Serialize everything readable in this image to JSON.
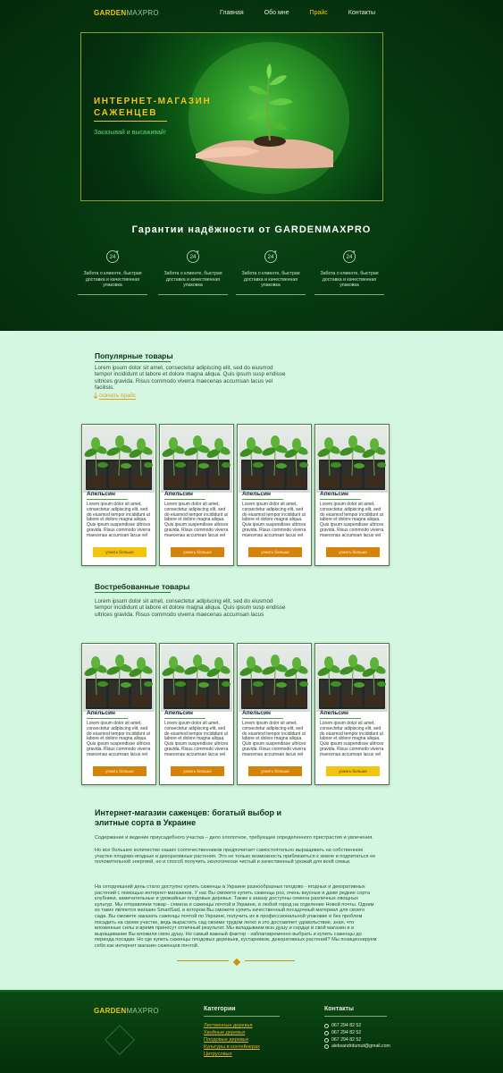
{
  "brand": {
    "part1": "GARDEN",
    "part2": "MAXPRO"
  },
  "nav": [
    {
      "label": "Главная",
      "active": false
    },
    {
      "label": "Обо мне",
      "active": false
    },
    {
      "label": "Прайс",
      "active": true
    },
    {
      "label": "Контакты",
      "active": false
    }
  ],
  "hero": {
    "title": "ИНТЕРНЕТ-МАГАЗИН САЖЕНЦЕВ",
    "subtitle": "Заказывай и высаживай!"
  },
  "guarantee": {
    "title": "Гарантии надёжности от GARDENMAXPRO",
    "features": [
      {
        "icon": "24",
        "text": "Забота о клиенте, быстрая доставка и качественная упаковка"
      },
      {
        "icon": "24",
        "text": "Забота о клиенте, быстрая доставка и качественная упаковка"
      },
      {
        "icon": "24",
        "text": "Забота о клиенте, быстрая доставка и качественная упаковка"
      },
      {
        "icon": "24",
        "text": "Забота о клиенте, быстрая доставка и качественная упаковка"
      }
    ]
  },
  "popular": {
    "title": "Популярные товары",
    "text": "Lorem ipsum dolor sit amet, consectetur adipiscing elit, sed do eiusmod tempor incididunt ut labore et dolore magna aliqua. Quis ipsum susp endisse ultrices gravida. Risus commodo viverra maecenas accumsan lacus vel facilisis.",
    "link": "скачать прайс"
  },
  "demanded": {
    "title": "Востребованные товары",
    "text": "Lorem ipsum dolor sit amet, consectetur adipiscing elit, sed do eiusmod tempor incididunt ut labore et dolore magna aliqua. Quis ipsum susp endisse ultrices gravida. Risus commodo viverra maecenas accumsan lacus"
  },
  "product": {
    "name": "Апельсин",
    "text": "Lorem ipsum dolor sit amet, consectetur adipiscing elit, sed do eiusmod tempor incididunt ut labore et dolore magna aliqua. Quis ipsum suspendisse ultrices gravida. Risus commodo viverra maecenas accumsan lacus vel",
    "button": "узнать больше"
  },
  "shop": {
    "title": "Интернет-магазин саженцев: богатый выбор и элитные сорта в Украине",
    "p1": "Содержание и ведение приусадебного участка – дело хлопотное, требующее определенного пристрастия и увлечения.",
    "p2": "Но все большее количество наших соотечественников предпочитает самостоятельно выращивать на собственном участке плодово-ягодные и декоративные растения. Это не только возможность приблизиться к земле и подпитаться ее положительной энергией, но и способ получить экологически чистый и качественный урожай для всей семьи.",
    "p3": "На сегодняшний день стало доступно купить саженцы в Украине разнообразных плодово - ягодных и декоративных растений с помощью интернет-магазинов. У нас Вы сможете купить саженцы роз, очень вкусные и даже редкие сорта клубники, замечательные и урожайные плодовые деревья. Также к заказу доступны семена различных овощных культур. Мы отправляем товар - семена и саженцы почтой в Украине, в любой город на отделение Новой почты. Одним из таких является магазин SmartSad, в котором Вы сможете купить качественный посадочный материал для своего сада. Вы сможете заказать саженцы почтой по Украине, получить их в профессиональной упаковке и без проблем посадить на своем участке, ведь вырастить сад своими трудом легко и это доставляет удовольствие, зная, что вложенные силы и время принесут отличный результат. Мы вкладываем всю душу и сердце в свой магазин и в выращивание Вы вложили свою душу. Но самый важный фактор - заблаговременно выбрать и купить саженцы до периода посадки. Но где купить саженцы плодовых деревьев, кустарников, декоративных растений? Мы позиционируем себя как интернет магазин саженцев почтой."
  },
  "footer": {
    "categories_title": "Категории",
    "categories": [
      "Лиственные деревья",
      "Хвойные деревья",
      "Плодовые деревья",
      "Культуры в контейнерах",
      "Цитрусовые"
    ],
    "contacts_title": "Контакты",
    "phones": [
      "067 294 82 52",
      "067 294 82 52",
      "067 294 82 52"
    ],
    "email": "aleksandrdumut@gmail.com"
  },
  "colors": {
    "accent": "#f2c418",
    "button_yellow": "#f4c40d",
    "button_orange": "#d6830a",
    "dark_green": "#063a10",
    "mint": "#d4f7e2"
  }
}
